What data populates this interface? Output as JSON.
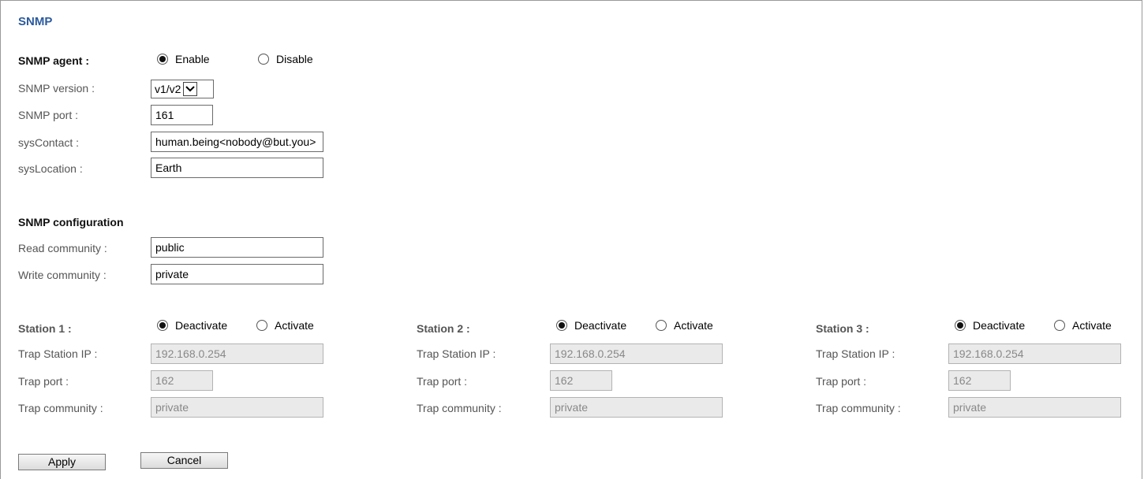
{
  "title": "SNMP",
  "agent": {
    "label": "SNMP agent :",
    "options": [
      "Enable",
      "Disable"
    ],
    "selected": "Enable",
    "version_label": "SNMP version :",
    "version_value": "v1/v2",
    "port_label": "SNMP port :",
    "port_value": "161",
    "contact_label": "sysContact :",
    "contact_value": "human.being<nobody@but.you>",
    "location_label": "sysLocation :",
    "location_value": "Earth"
  },
  "config": {
    "heading": "SNMP configuration",
    "read_label": "Read community :",
    "read_value": "public",
    "write_label": "Write community :",
    "write_value": "private"
  },
  "stations": [
    {
      "label": "Station 1 :",
      "options": [
        "Deactivate",
        "Activate"
      ],
      "selected": "Deactivate",
      "ip_label": "Trap Station IP :",
      "ip_value": "192.168.0.254",
      "port_label": "Trap port :",
      "port_value": "162",
      "community_label": "Trap community :",
      "community_value": "private"
    },
    {
      "label": "Station 2 :",
      "options": [
        "Deactivate",
        "Activate"
      ],
      "selected": "Deactivate",
      "ip_label": "Trap Station IP :",
      "ip_value": "192.168.0.254",
      "port_label": "Trap port :",
      "port_value": "162",
      "community_label": "Trap community :",
      "community_value": "private"
    },
    {
      "label": "Station 3 :",
      "options": [
        "Deactivate",
        "Activate"
      ],
      "selected": "Deactivate",
      "ip_label": "Trap Station IP :",
      "ip_value": "192.168.0.254",
      "port_label": "Trap port :",
      "port_value": "162",
      "community_label": "Trap community :",
      "community_value": "private"
    }
  ],
  "buttons": {
    "apply": "Apply",
    "cancel": "Cancel"
  },
  "icons": {
    "select_arrow": "chevron-down-icon"
  },
  "colors": {
    "title": "#2b5a9e",
    "disabled_field": "#eaeaea"
  }
}
